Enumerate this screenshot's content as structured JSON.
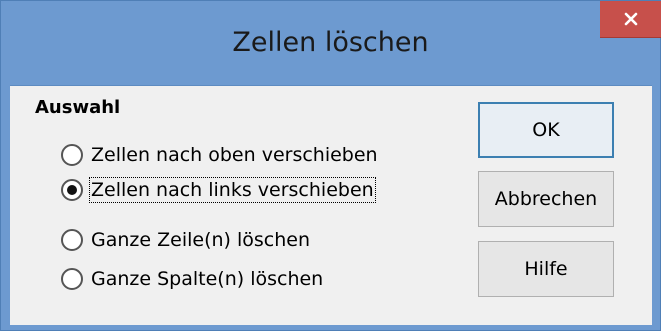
{
  "window": {
    "title": "Zellen löschen"
  },
  "group": {
    "title": "Auswahl"
  },
  "options": [
    {
      "label": "Zellen nach oben verschieben",
      "checked": false
    },
    {
      "label": "Zellen nach links verschieben",
      "checked": true
    },
    {
      "label": "Ganze Zeile(n) löschen",
      "checked": false
    },
    {
      "label": "Ganze Spalte(n) löschen",
      "checked": false
    }
  ],
  "buttons": {
    "ok": "OK",
    "cancel": "Abbrechen",
    "help": "Hilfe"
  },
  "icons": {
    "close": "close-icon"
  }
}
